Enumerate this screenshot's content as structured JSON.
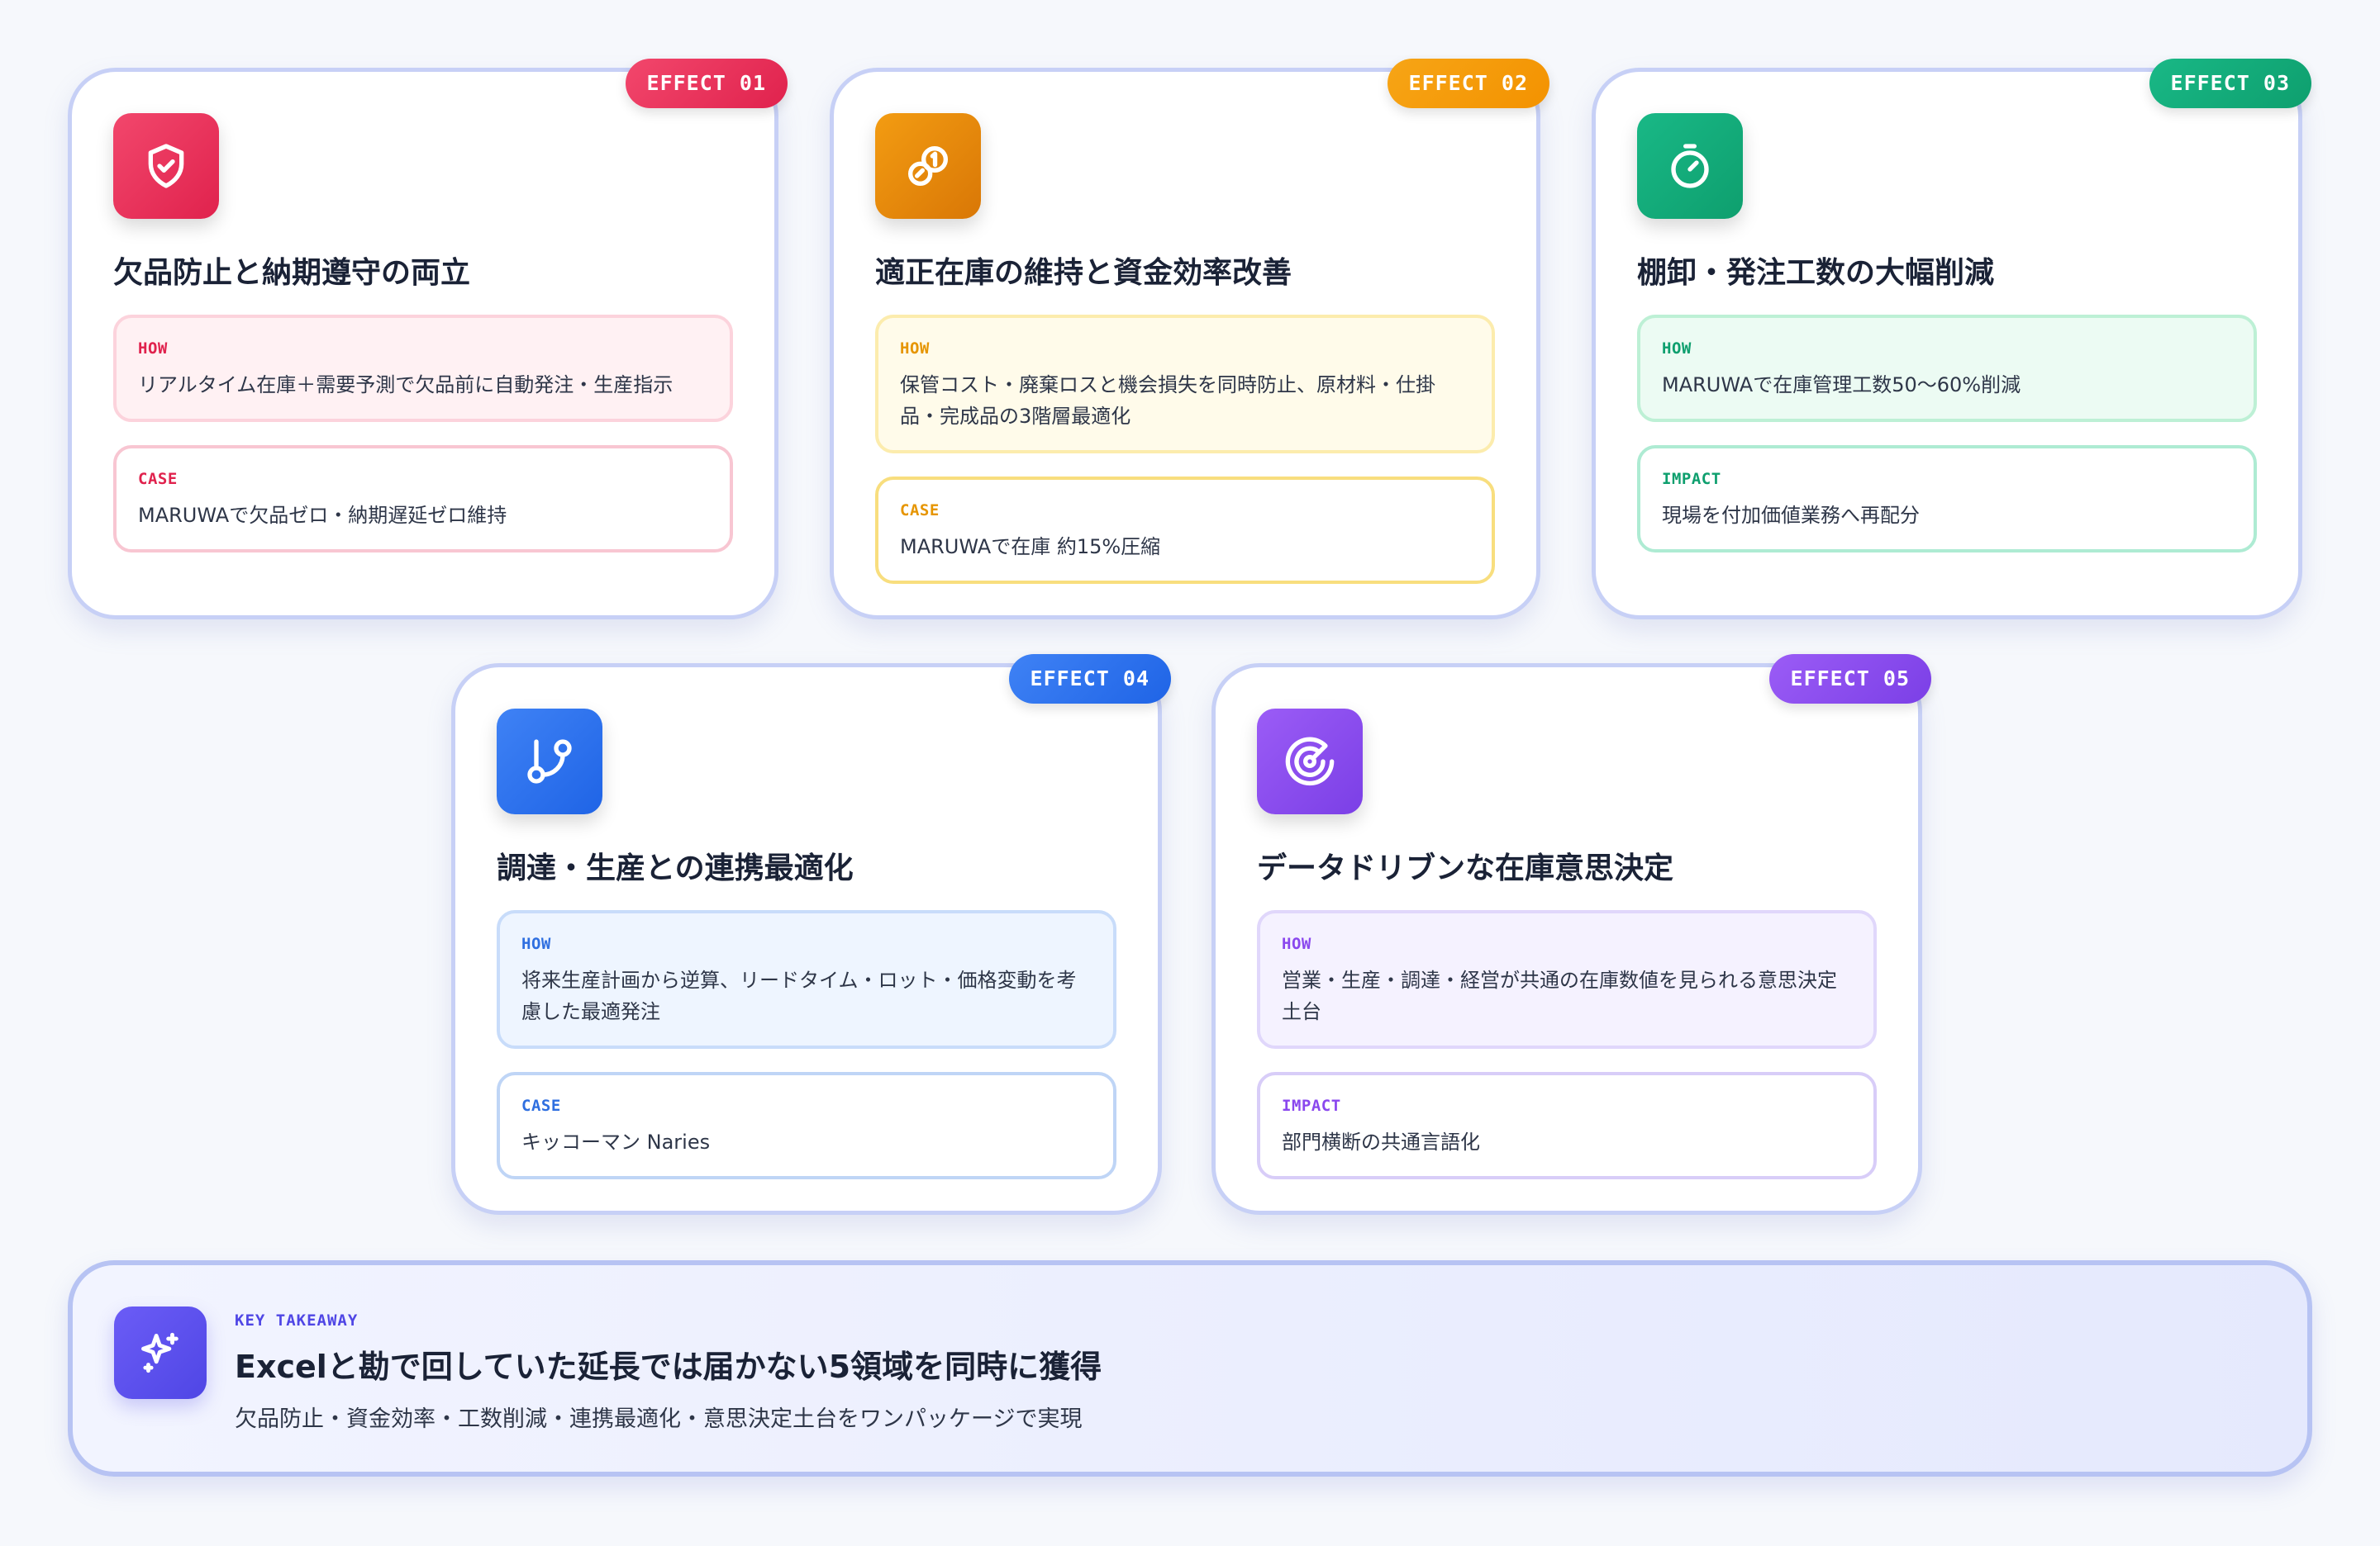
{
  "cards": [
    {
      "badge": "EFFECT 01",
      "icon": "shield-check-icon",
      "color": "#e0224d",
      "title": "欠品防止と納期遵守の両立",
      "box1": {
        "label": "HOW",
        "text": "リアルタイム在庫＋需要予測で欠品前に自動発注・生産指示"
      },
      "box2": {
        "label": "CASE",
        "text": "MARUWAで欠品ゼロ・納期遅延ゼロ維持"
      }
    },
    {
      "badge": "EFFECT 02",
      "icon": "coins-icon",
      "color": "#f39200",
      "title": "適正在庫の維持と資金効率改善",
      "box1": {
        "label": "HOW",
        "text": "保管コスト・廃棄ロスと機会損失を同時防止、原材料・仕掛品・完成品の3階層最適化"
      },
      "box2": {
        "label": "CASE",
        "text": "MARUWAで在庫 約15%圧縮"
      }
    },
    {
      "badge": "EFFECT 03",
      "icon": "stopwatch-icon",
      "color": "#0e9f6e",
      "title": "棚卸・発注工数の大幅削減",
      "box1": {
        "label": "HOW",
        "text": "MARUWAで在庫管理工数50〜60%削減"
      },
      "box2": {
        "label": "IMPACT",
        "text": "現場を付加価値業務へ再配分"
      }
    },
    {
      "badge": "EFFECT 04",
      "icon": "git-branch-icon",
      "color": "#1f64e6",
      "title": "調達・生産との連携最適化",
      "box1": {
        "label": "HOW",
        "text": "将来生産計画から逆算、リードタイム・ロット・価格変動を考慮した最適発注"
      },
      "box2": {
        "label": "CASE",
        "text": "キッコーマン Naries"
      }
    },
    {
      "badge": "EFFECT 05",
      "icon": "radar-icon",
      "color": "#7b3fe6",
      "title": "データドリブンな在庫意思決定",
      "box1": {
        "label": "HOW",
        "text": "営業・生産・調達・経営が共通の在庫数値を見られる意思決定土台"
      },
      "box2": {
        "label": "IMPACT",
        "text": "部門横断の共通言語化"
      }
    }
  ],
  "takeaway": {
    "label": "KEY TAKEAWAY",
    "icon": "sparkles-icon",
    "title": "Excelと勘で回していた延長では届かない5領域を同時に獲得",
    "subtitle": "欠品防止・資金効率・工数削減・連携最適化・意思決定土台をワンパッケージで実現"
  }
}
